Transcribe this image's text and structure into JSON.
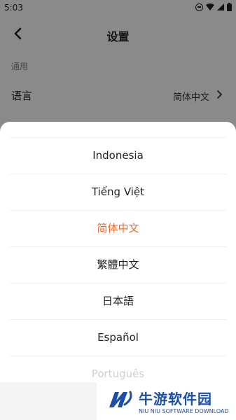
{
  "status_bar": {
    "time": "5:03",
    "icons": [
      "do-not-disturb-icon",
      "wifi-icon",
      "signal-icon",
      "battery-icon"
    ]
  },
  "header": {
    "title": "设置"
  },
  "settings": {
    "section_label": "通用",
    "language_row": {
      "label": "语言",
      "value": "简体中文"
    }
  },
  "language_sheet": {
    "options": [
      {
        "label": "Indonesia"
      },
      {
        "label": "Tiếng Việt"
      },
      {
        "label": "简体中文"
      },
      {
        "label": "繁體中文"
      },
      {
        "label": "日本語"
      },
      {
        "label": "Español"
      },
      {
        "label": "Português"
      }
    ],
    "selected_label": "简体中文",
    "selected_color": "#f26b2c"
  },
  "watermark": {
    "title": "牛游软件园",
    "subtitle": "NIU NIU SOFTWARE DOWNLOAD"
  }
}
